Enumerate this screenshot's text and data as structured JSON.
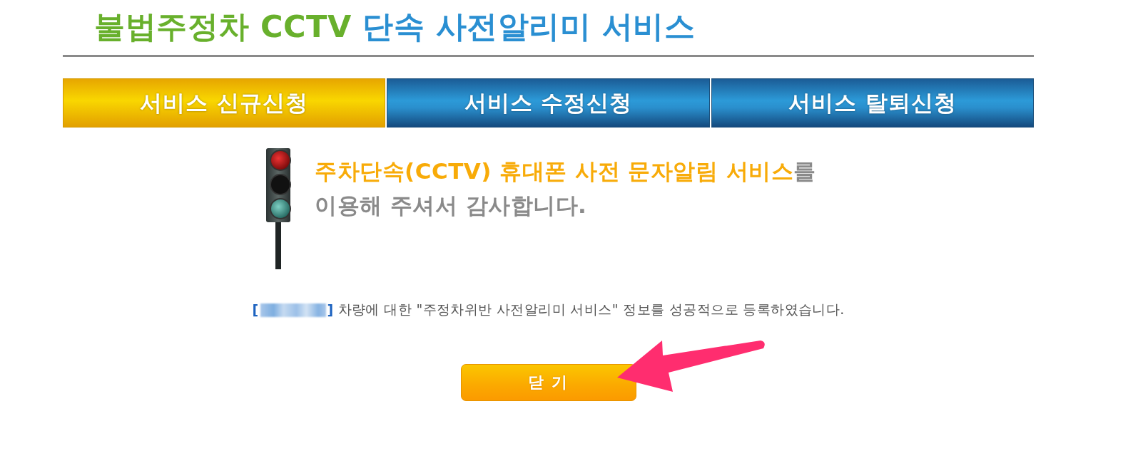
{
  "title": [
    "불법주정차 CCTV",
    "단속 사전알리미 서비스"
  ],
  "tabs": [
    {
      "label": "서비스 신규신청",
      "selected": true
    },
    {
      "label": "서비스 수정신청",
      "selected": false
    },
    {
      "label": "서비스 탈퇴신청",
      "selected": false
    }
  ],
  "message": {
    "line_1_highlight": "주차단속(CCTV) 휴대폰 사전 문자알림 서비스",
    "line_1_rest": "를",
    "line_2": "이용해 주셔서 감사합니다."
  },
  "result": {
    "plate_open": "[",
    "plate_close": "]",
    "text": "차량에 대한 \"주정차위반 사전알리미 서비스\" 정보를 성공적으로 등록하였습니다."
  },
  "close_button": {
    "label": "닫 기"
  }
}
